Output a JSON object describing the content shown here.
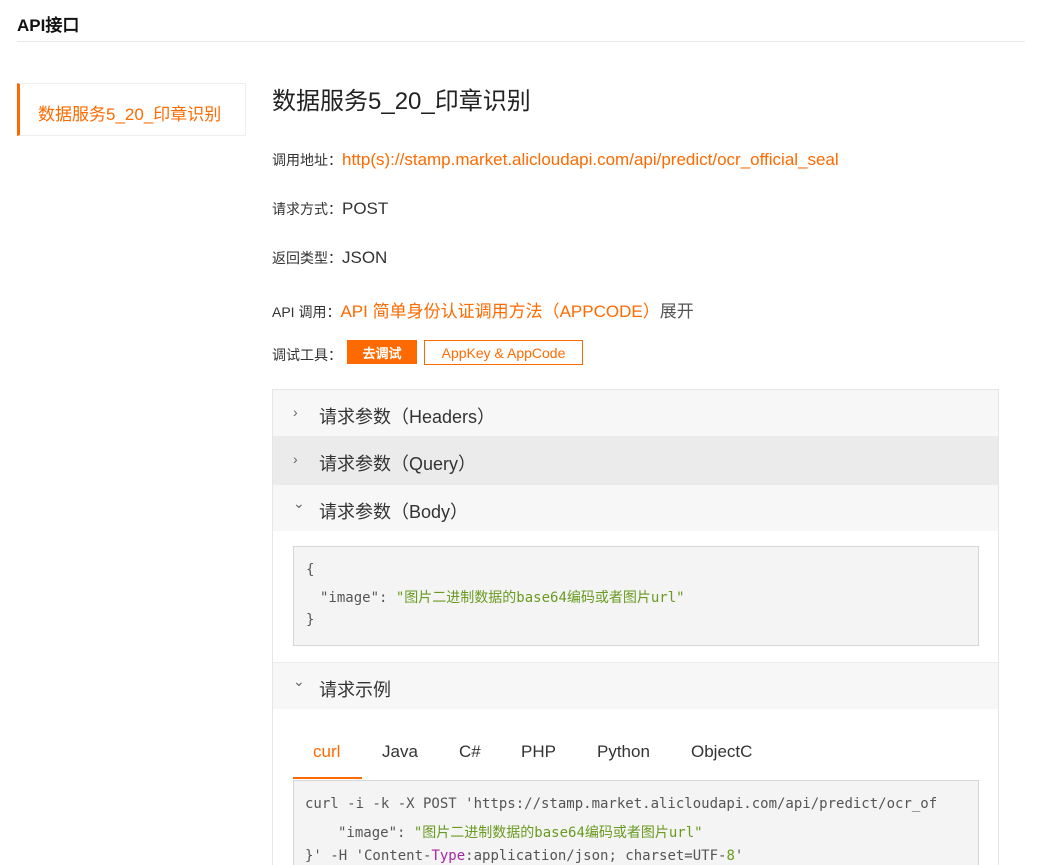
{
  "header": {
    "title": "API接口"
  },
  "sidebar": {
    "items": [
      {
        "label": "数据服务5_20_印章识别",
        "active": true
      }
    ]
  },
  "main": {
    "title": "数据服务5_20_印章识别",
    "call_address": {
      "label": "调用地址：",
      "value": "http(s)://stamp.market.alicloudapi.com/api/predict/ocr_official_seal"
    },
    "request_method": {
      "label": "请求方式：",
      "value": "POST"
    },
    "return_type": {
      "label": "返回类型：",
      "value": "JSON"
    },
    "api_call": {
      "label": "API 调用：",
      "link": "API 简单身份认证调用方法（APPCODE）",
      "expand": "展开"
    },
    "debug_tool": {
      "label": "调试工具：",
      "debug_button": "去调试",
      "key_button": "AppKey & AppCode"
    }
  },
  "accordion": {
    "headers": {
      "chevron": "›",
      "label": "请求参数（Headers）",
      "expanded": false
    },
    "query": {
      "chevron": "›",
      "label": "请求参数（Query）",
      "expanded": false
    },
    "body": {
      "chevron": "⌄",
      "label": "请求参数（Body）",
      "expanded": true
    },
    "example": {
      "chevron": "⌄",
      "label": "请求示例",
      "expanded": true
    }
  },
  "body_code": {
    "open": "{",
    "key": "\"image\"",
    "sep": ": ",
    "value": "\"图片二进制数据的base64编码或者图片url\"",
    "close": "}"
  },
  "example_tabs": [
    "curl",
    "Java",
    "C#",
    "PHP",
    "Python",
    "ObjectC"
  ],
  "active_tab": "curl",
  "curl_code": {
    "line1": "curl -i -k -X POST 'https://stamp.market.alicloudapi.com/api/predict/ocr_of",
    "line2_key": "\"image\"",
    "line2_sep": ": ",
    "line2_value": "\"图片二进制数据的base64编码或者图片url\"",
    "line3_a": "}' -H 'Content-",
    "line3_kw": "Type",
    "line3_b": ":application/json; charset=UTF-",
    "line3_num": "8",
    "line3_c": "'"
  },
  "colors": {
    "accent": "#ff6a00",
    "string": "#6a9a1f",
    "keyword": "#a626a4"
  },
  "icons": {
    "collapsed": "chevron-right-icon",
    "expanded": "chevron-down-icon"
  }
}
